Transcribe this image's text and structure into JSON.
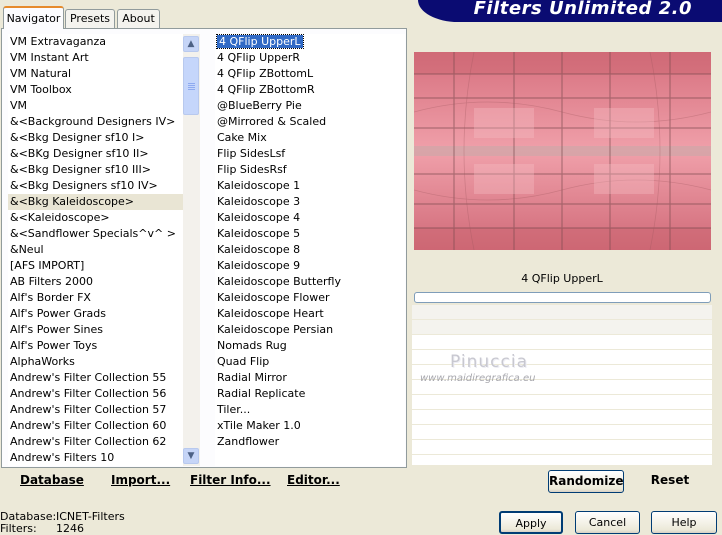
{
  "app": {
    "title": "Filters Unlimited 2.0"
  },
  "tabs": [
    {
      "label": "Navigator",
      "active": true
    },
    {
      "label": "Presets",
      "active": false
    },
    {
      "label": "About",
      "active": false
    }
  ],
  "categories": {
    "items": [
      "VM Extravaganza",
      "VM Instant Art",
      "VM Natural",
      "VM Toolbox",
      "VM",
      "&<Background Designers IV>",
      "&<Bkg Designer sf10 I>",
      "&<BKg Designer sf10 II>",
      "&<Bkg Designer sf10 III>",
      "&<Bkg Designers sf10 IV>",
      "&<Bkg Kaleidoscope>",
      "&<Kaleidoscope>",
      "&<Sandflower Specials^v^ >",
      "&Neul",
      "[AFS IMPORT]",
      "AB Filters 2000",
      "Alf's Border FX",
      "Alf's Power Grads",
      "Alf's Power Sines",
      "Alf's Power Toys",
      "AlphaWorks",
      "Andrew's Filter Collection 55",
      "Andrew's Filter Collection 56",
      "Andrew's Filter Collection 57",
      "Andrew's Filter Collection 60",
      "Andrew's Filter Collection 62",
      "Andrew's Filters 10"
    ],
    "selected_index": 10
  },
  "filters": {
    "items": [
      "4 QFlip UpperL",
      "4 QFlip UpperR",
      "4 QFlip ZBottomL",
      "4 QFlip ZBottomR",
      "@BlueBerry Pie",
      "@Mirrored & Scaled",
      "Cake Mix",
      "Flip SidesLsf",
      "Flip SidesRsf",
      "Kaleidoscope 1",
      "Kaleidoscope 3",
      "Kaleidoscope 4",
      "Kaleidoscope 5",
      "Kaleidoscope 8",
      "Kaleidoscope 9",
      "Kaleidoscope Butterfly",
      "Kaleidoscope Flower",
      "Kaleidoscope Heart",
      "Kaleidoscope Persian",
      "Nomads Rug",
      "Quad Flip",
      "Radial Mirror",
      "Radial Replicate",
      "Tiler...",
      "xTile Maker 1.0",
      "Zandflower"
    ],
    "selected_index": 0
  },
  "preview": {
    "filter_name": "4 QFlip UpperL",
    "progress": 0
  },
  "watermark": {
    "name": "Pinuccia",
    "url": "www.maidiregrafica.eu"
  },
  "links": {
    "database": "Database",
    "import": "Import...",
    "filter_info": "Filter Info...",
    "editor": "Editor..."
  },
  "buttons": {
    "randomize": "Randomize",
    "reset": "Reset",
    "apply": "Apply",
    "cancel": "Cancel",
    "help": "Help"
  },
  "status": {
    "database_label": "Database:",
    "database_value": "ICNET-Filters",
    "filters_label": "Filters:",
    "filters_value": "1246"
  },
  "colors": {
    "banner": "#0a0b72",
    "selection": "#316ac5",
    "preview_pink": "#e47f8c",
    "background": "#ece9d8"
  }
}
